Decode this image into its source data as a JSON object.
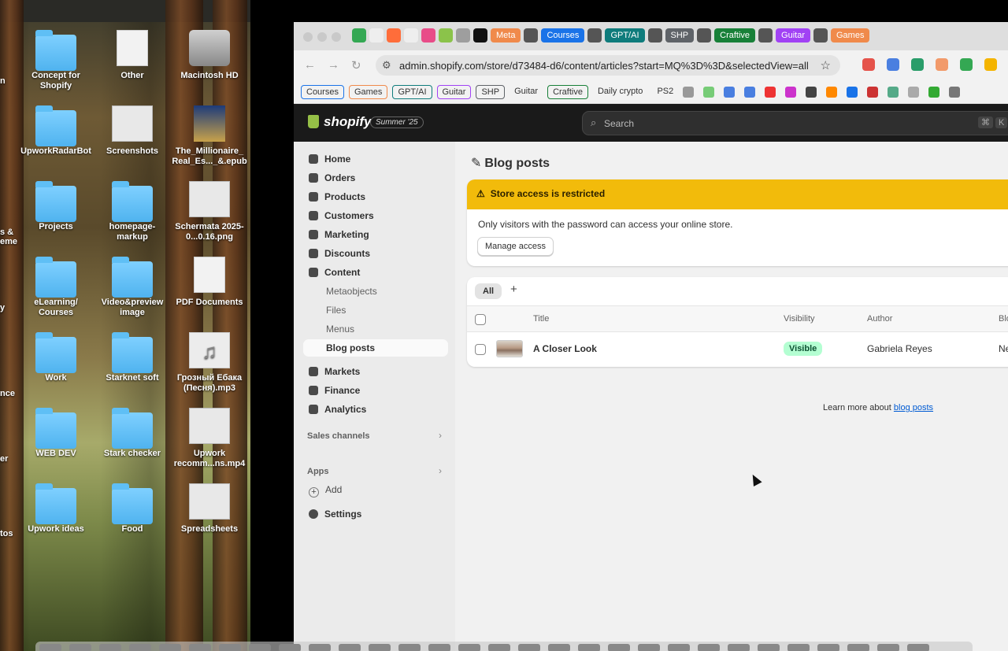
{
  "desktop": {
    "icons": [
      {
        "label": "Concept for Shopify",
        "kind": "folder"
      },
      {
        "label": "Other",
        "kind": "zip"
      },
      {
        "label": "Macintosh HD",
        "kind": "disk"
      },
      {
        "label": "UpworkRadarBot",
        "kind": "folder"
      },
      {
        "label": "Screenshots",
        "kind": "image"
      },
      {
        "label": "The_Millionaire_ Real_Es..._&.epub",
        "kind": "book"
      },
      {
        "label": "Projects",
        "kind": "folder"
      },
      {
        "label": "homepage-markup",
        "kind": "folder"
      },
      {
        "label": "Schermata 2025-0...0.16.png",
        "kind": "image"
      },
      {
        "label": "eLearning/ Courses",
        "kind": "folder"
      },
      {
        "label": "Video&preview image",
        "kind": "folder"
      },
      {
        "label": "PDF Documents",
        "kind": "pdf"
      },
      {
        "label": "Work",
        "kind": "folder"
      },
      {
        "label": "Starknet soft",
        "kind": "folder"
      },
      {
        "label": "Грозный Ебака (Песня).mp3",
        "kind": "music"
      },
      {
        "label": "WEB DEV",
        "kind": "folder"
      },
      {
        "label": "Stark checker",
        "kind": "folder"
      },
      {
        "label": "Upwork recomm...ns.mp4",
        "kind": "video"
      },
      {
        "label": "Upwork ideas",
        "kind": "folder"
      },
      {
        "label": "Food",
        "kind": "folder"
      },
      {
        "label": "Spreadsheets",
        "kind": "image"
      }
    ],
    "edge_labels": [
      "n",
      "s &",
      "eme",
      "y",
      "nce",
      "er",
      "tos"
    ]
  },
  "browser": {
    "tab_groups": [
      {
        "label": "Meta",
        "color": "#f08a4b"
      },
      {
        "label": "Courses",
        "color": "#1a73e8"
      },
      {
        "label": "GPT/AI",
        "color": "#0f7c7c"
      },
      {
        "label": "SHP",
        "color": "#5f6368"
      },
      {
        "label": "Craftive",
        "color": "#188038"
      },
      {
        "label": "Guitar",
        "color": "#a142f4"
      },
      {
        "label": "Games",
        "color": "#f08a4b"
      }
    ],
    "url": "admin.shopify.com/store/d73484-d6/content/articles?start=MQ%3D%3D&selectedView=all",
    "bookmarks": [
      {
        "label": "Courses",
        "color": "#1a73e8",
        "group": true
      },
      {
        "label": "Games",
        "color": "#f08a4b",
        "group": true
      },
      {
        "label": "GPT/AI",
        "color": "#0f7c7c",
        "group": true
      },
      {
        "label": "Guitar",
        "color": "#a142f4",
        "group": true
      },
      {
        "label": "SHP",
        "color": "#5f6368",
        "group": true
      },
      {
        "label": "Guitar",
        "color": "",
        "group": false
      },
      {
        "label": "Craftive",
        "color": "#188038",
        "group": true
      },
      {
        "label": "Daily crypto",
        "color": "",
        "group": false
      },
      {
        "label": "PS2",
        "color": "",
        "group": false
      }
    ]
  },
  "shopify": {
    "logo": "shopify",
    "edition": "Summer '25",
    "search_placeholder": "Search",
    "shortcut": [
      "⌘",
      "K"
    ],
    "nav": [
      {
        "label": "Home",
        "icon": "home-icon"
      },
      {
        "label": "Orders",
        "icon": "orders-icon"
      },
      {
        "label": "Products",
        "icon": "tag-icon"
      },
      {
        "label": "Customers",
        "icon": "person-icon"
      },
      {
        "label": "Marketing",
        "icon": "target-icon"
      },
      {
        "label": "Discounts",
        "icon": "discount-icon"
      },
      {
        "label": "Content",
        "icon": "content-icon"
      }
    ],
    "content_sub": [
      "Metaobjects",
      "Files",
      "Menus",
      "Blog posts"
    ],
    "nav2": [
      {
        "label": "Markets",
        "icon": "globe-icon"
      },
      {
        "label": "Finance",
        "icon": "bank-icon"
      },
      {
        "label": "Analytics",
        "icon": "chart-icon"
      }
    ],
    "sales_channels": "Sales channels",
    "apps": "Apps",
    "add": "Add",
    "settings": "Settings",
    "page_title": "Blog posts",
    "banner": {
      "title": "Store access is restricted",
      "text": "Only visitors with the password can access your online store.",
      "button": "Manage access"
    },
    "view_tab": "All",
    "columns": {
      "title": "Title",
      "visibility": "Visibility",
      "author": "Author",
      "blog": "Blo"
    },
    "rows": [
      {
        "title": "A Closer Look",
        "visibility": "Visible",
        "author": "Gabriela Reyes",
        "blog": "Ne"
      }
    ],
    "learn_more_prefix": "Learn more about ",
    "learn_more_link": "blog posts"
  }
}
